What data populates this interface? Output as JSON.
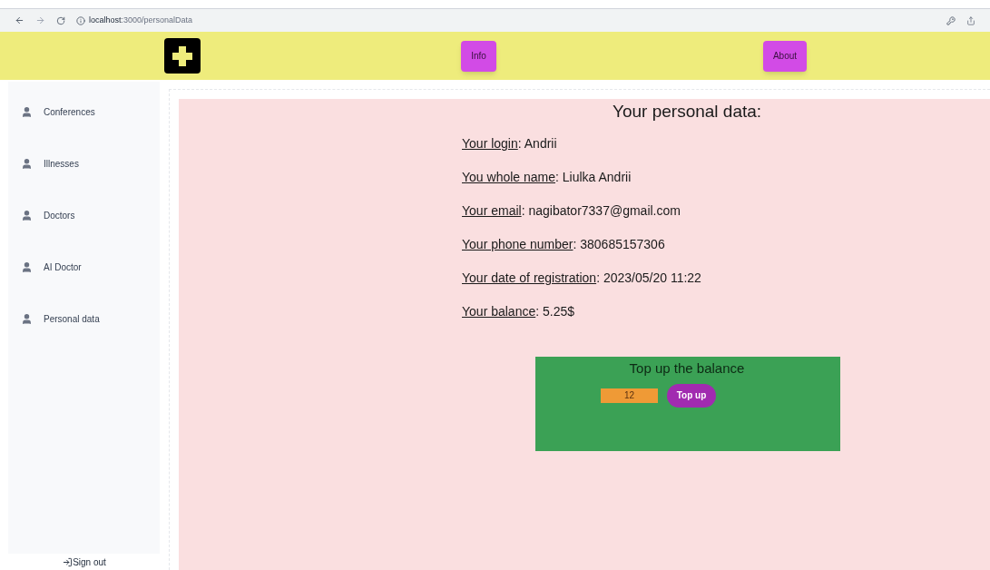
{
  "browser": {
    "url_host": "localhost",
    "url_path": ":3000/personalData"
  },
  "header": {
    "buttons": [
      "Info",
      "About"
    ]
  },
  "sidebar": {
    "items": [
      {
        "label": "Conferences"
      },
      {
        "label": "Illnesses"
      },
      {
        "label": "Doctors"
      },
      {
        "label": "AI Doctor"
      },
      {
        "label": "Personal data"
      }
    ],
    "sign_out": "Sign out"
  },
  "main": {
    "title": "Your personal data:",
    "fields": [
      {
        "label": "Your login",
        "value": ": Andrii"
      },
      {
        "label": "You whole name",
        "value": ": Liulka Andrii"
      },
      {
        "label": "Your email",
        "value": ": nagibator7337@gmail.com"
      },
      {
        "label": "Your phone number",
        "value": ": 380685157306"
      },
      {
        "label": "Your date of registration",
        "value": ": 2023/05/20 11:22"
      },
      {
        "label": "Your balance",
        "value": ": 5.25$"
      }
    ],
    "top_up": {
      "title": "Top up the balance",
      "amount": "12",
      "button": "Top up"
    }
  }
}
